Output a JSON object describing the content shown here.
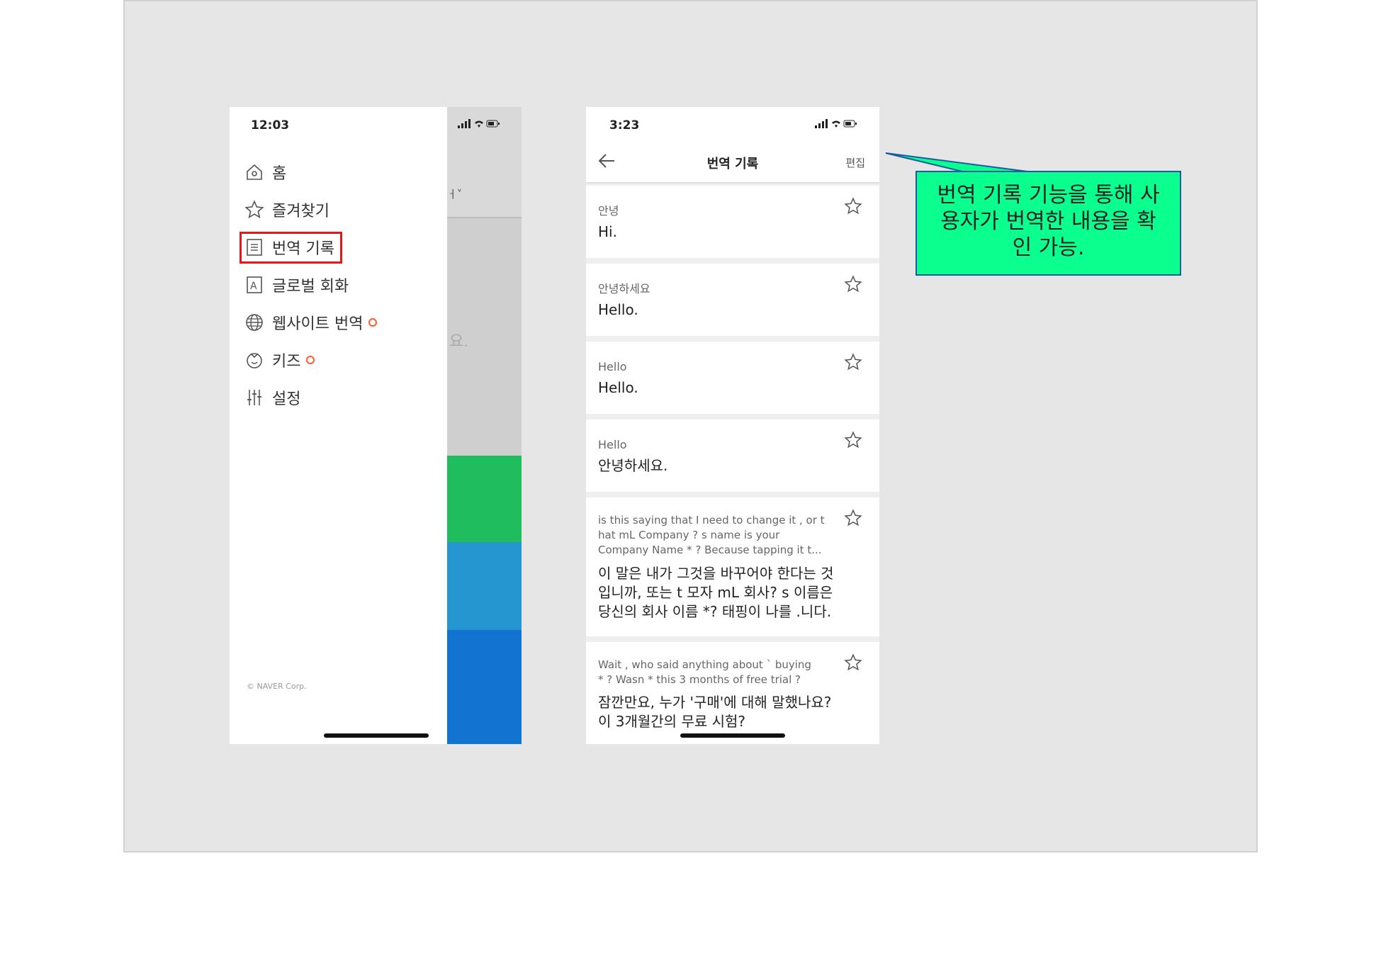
{
  "phone1": {
    "time": "12:03",
    "status_icons": "signal-wifi-battery",
    "menu": [
      {
        "label": "홈",
        "icon": "home-icon"
      },
      {
        "label": "즐겨찾기",
        "icon": "star-icon"
      },
      {
        "label": "번역 기록",
        "icon": "history-icon"
      },
      {
        "label": "글로벌 회화",
        "icon": "conversation-icon"
      },
      {
        "label": "웹사이트 번역",
        "icon": "globe-icon",
        "badge": true
      },
      {
        "label": "키즈",
        "icon": "kids-icon",
        "badge": true
      },
      {
        "label": "설정",
        "icon": "settings-icon"
      }
    ],
    "copyright": "© NAVER Corp.",
    "bg_fragment_1": "ㅓ˅",
    "bg_fragment_2": "요."
  },
  "phone2": {
    "time": "3:23",
    "title": "번역 기록",
    "edit_label": "편집",
    "items": [
      {
        "source": "안녕",
        "target": "Hi."
      },
      {
        "source": "안녕하세요",
        "target": "Hello."
      },
      {
        "source": "Hello",
        "target": "Hello."
      },
      {
        "source": "Hello",
        "target": "안녕하세요."
      },
      {
        "source_lines": [
          "is this saying that I need to  change it , or t",
          "hat mL  Company ? s name is your",
          "Company Name * ?  Because tapping it  t..."
        ],
        "target_lines": [
          "이 말은 내가 그것을 바꾸어야 한다는 것",
          "입니까, 또는 t 모자 mL 회사? s 이름은",
          "당신의 회사 이름 *? 태핑이 나를  .니다."
        ]
      },
      {
        "source_lines": [
          "Wait , who said anything  about ` buying",
          "* ? Wasn * this  3 months of free trial ?"
        ],
        "target_lines": [
          "잠깐만요, 누가 '구매'에 대해 말했나요?",
          "이 3개월간의 무료 시험?"
        ]
      }
    ]
  },
  "callout": {
    "lines": [
      "번역 기록 기능을 통해 사",
      "용자가 번역한 내용을 확",
      "인 가능."
    ]
  },
  "colors": {
    "slide_bg": "#e6e6e6",
    "highlight": "#e01a1a",
    "callout_bg": "#0aff8e",
    "badge": "#ff5b2e",
    "strip_green": "#20bd5e",
    "strip_teal": "#2596cf",
    "strip_blue": "#1274d0"
  }
}
